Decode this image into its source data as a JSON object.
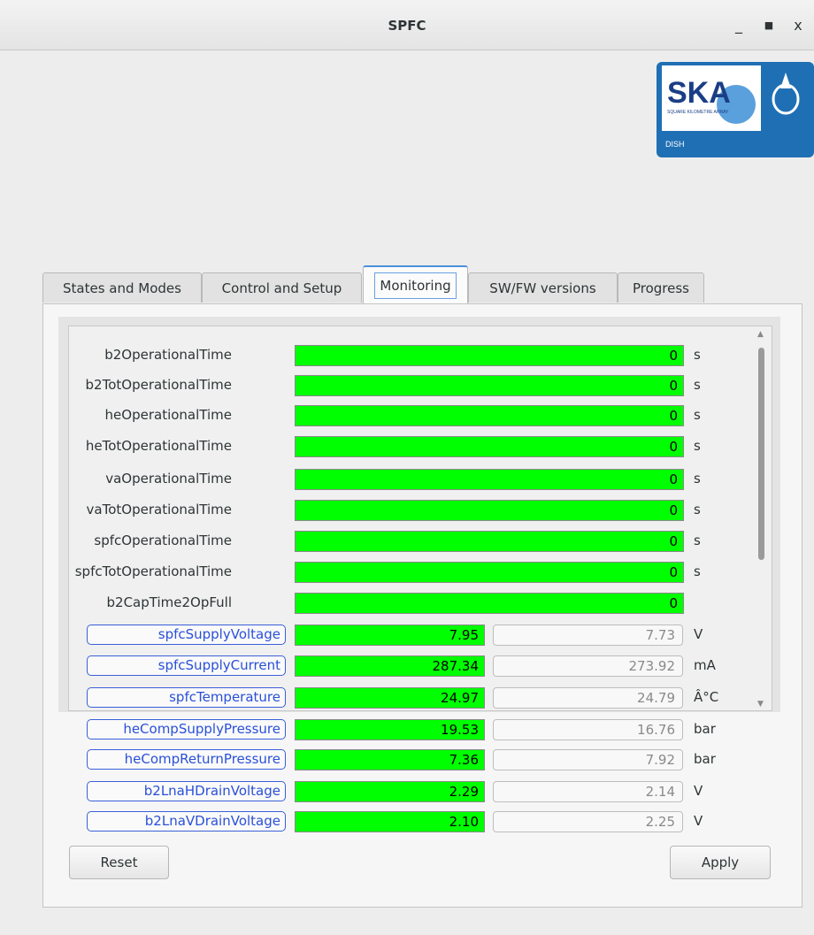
{
  "window": {
    "title": "SPFC",
    "minimize": "_",
    "maximize": "■",
    "close": "x"
  },
  "logo": {
    "text": "SKA",
    "subtitle": "SQUARE KILOMETRE ARRAY",
    "caption": "DISH"
  },
  "tabs": [
    {
      "label": "States and Modes"
    },
    {
      "label": "Control and Setup"
    },
    {
      "label": "Monitoring"
    },
    {
      "label": "SW/FW versions"
    },
    {
      "label": "Progress"
    }
  ],
  "active_tab": "Monitoring",
  "rows": [
    {
      "label": "b2OperationalTime",
      "value": "0",
      "unit": "s"
    },
    {
      "label": "b2TotOperationalTime",
      "value": "0",
      "unit": "s"
    },
    {
      "label": "heOperationalTime",
      "value": "0",
      "unit": "s"
    },
    {
      "label": "heTotOperationalTime",
      "value": "0",
      "unit": "s"
    },
    {
      "label": "vaOperationalTime",
      "value": "0",
      "unit": "s"
    },
    {
      "label": "vaTotOperationalTime",
      "value": "0",
      "unit": "s"
    },
    {
      "label": "spfcOperationalTime",
      "value": "0",
      "unit": "s"
    },
    {
      "label": "spfcTotOperationalTime",
      "value": "0",
      "unit": "s"
    },
    {
      "label": "b2CapTime2OpFull",
      "value": "0",
      "unit": ""
    },
    {
      "label": "spfcSupplyVoltage",
      "value": "7.95",
      "setpoint": "7.73",
      "unit": "V"
    },
    {
      "label": "spfcSupplyCurrent",
      "value": "287.34",
      "setpoint": "273.92",
      "unit": "mA"
    },
    {
      "label": "spfcTemperature",
      "value": "24.97",
      "setpoint": "24.79",
      "unit": "Â°C"
    },
    {
      "label": "heCompSupplyPressure",
      "value": "19.53",
      "setpoint": "16.76",
      "unit": "bar"
    },
    {
      "label": "heCompReturnPressure",
      "value": "7.36",
      "setpoint": "7.92",
      "unit": "bar"
    },
    {
      "label": "b2LnaHDrainVoltage",
      "value": "2.29",
      "setpoint": "2.14",
      "unit": "V"
    },
    {
      "label": "b2LnaVDrainVoltage",
      "value": "2.10",
      "setpoint": "2.25",
      "unit": "V"
    }
  ],
  "actions": {
    "reset": "Reset",
    "apply": "Apply"
  },
  "colors": {
    "bar": "#00ff00",
    "accent": "#4a90d9",
    "label_button": "#2a50d8"
  }
}
